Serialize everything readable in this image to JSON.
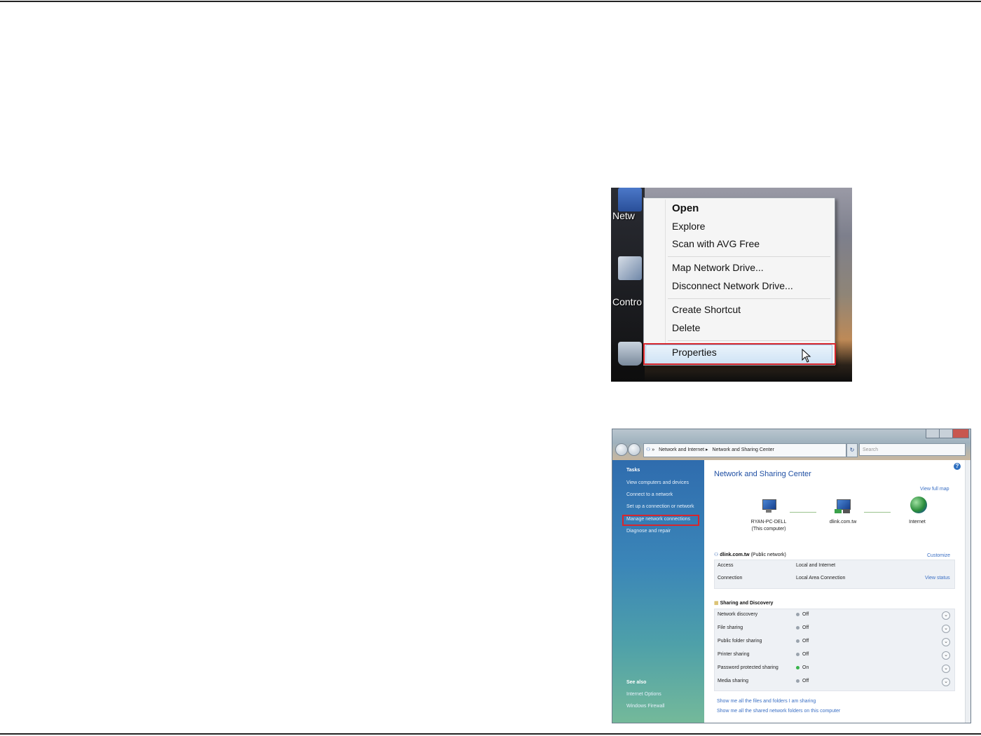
{
  "context_menu_shot": {
    "desktop_icons": [
      {
        "icon": "network-icon",
        "label": "Netw"
      },
      {
        "icon": "control-panel-icon",
        "label": "Contro"
      },
      {
        "icon": "recycle-bin-icon",
        "label": ""
      }
    ],
    "menu_items": {
      "open": "Open",
      "explore": "Explore",
      "scan": "Scan with AVG Free",
      "map_drive": "Map Network Drive...",
      "disconnect_drive": "Disconnect Network Drive...",
      "create_shortcut": "Create Shortcut",
      "delete": "Delete",
      "properties": "Properties"
    },
    "highlight_color": "#d8262d"
  },
  "nsc_shot": {
    "breadcrumb": [
      "Network and Internet",
      "Network and Sharing Center"
    ],
    "search_placeholder": "Search",
    "sidebar": {
      "tasks_heading": "Tasks",
      "tasks": [
        "View computers and devices",
        "Connect to a network",
        "Set up a connection or network",
        "Manage network connections",
        "Diagnose and repair"
      ],
      "see_also_heading": "See also",
      "see_also": [
        "Internet Options",
        "Windows Firewall"
      ]
    },
    "title": "Network and Sharing Center",
    "view_full_map": "View full map",
    "map": {
      "computer_name": "RYAN-PC-DELL",
      "computer_sub": "(This computer)",
      "network_name": "dlink.com.tw",
      "internet": "Internet"
    },
    "network": {
      "name": "dlink.com.tw",
      "type": "(Public network)",
      "customize": "Customize",
      "access_label": "Access",
      "access_value": "Local and Internet",
      "connection_label": "Connection",
      "connection_value": "Local Area Connection",
      "view_status": "View status"
    },
    "sharing": {
      "heading": "Sharing and Discovery",
      "rows": [
        {
          "label": "Network discovery",
          "value": "Off"
        },
        {
          "label": "File sharing",
          "value": "Off"
        },
        {
          "label": "Public folder sharing",
          "value": "Off"
        },
        {
          "label": "Printer sharing",
          "value": "Off"
        },
        {
          "label": "Password protected sharing",
          "value": "On"
        },
        {
          "label": "Media sharing",
          "value": "Off"
        }
      ]
    },
    "footer_links": [
      "Show me all the files and folders I am sharing",
      "Show me all the shared network folders on this computer"
    ],
    "status_on_color": "#37b34a",
    "status_off_color": "#9aa3ad"
  }
}
